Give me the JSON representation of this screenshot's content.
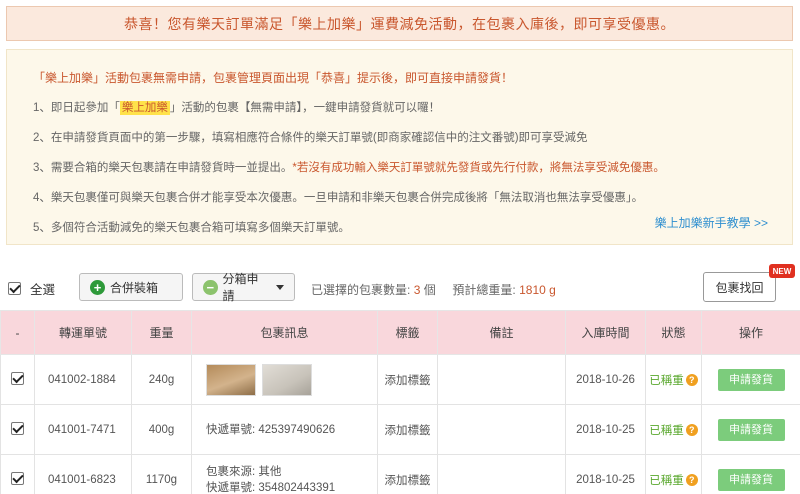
{
  "banner": {
    "text": "恭喜！您有樂天訂單滿足「樂上加樂」運費減免活動，在包裹入庫後，即可享受優惠。"
  },
  "info": {
    "intro": "「樂上加樂」活動包裹無需申請，包裹管理頁面出現「恭喜」提示後，即可直接申請發貨！",
    "item1_a": "1、即日起參加「",
    "item1_hl": "樂上加樂",
    "item1_b": "」活動的包裹【無需申請】，一鍵申請發貨就可以囉！",
    "item2": "2、在申請發貨頁面中的第一步驟，填寫相應符合條件的樂天訂單號(即商家確認信中的注文番號)即可享受減免",
    "item3_a": "3、需要合箱的樂天包裹請在申請發貨時一並提出。",
    "item3_b": "*若沒有成功輸入樂天訂單號就先發貨或先行付款，將無法享受減免優惠。",
    "item4": "4、樂天包裹僅可與樂天包裹合併才能享受本次優惠。一旦申請和非樂天包裹合併完成後將「無法取消也無法享受優惠」。",
    "item5": "5、多個符合活動減免的樂天包裹合箱可填寫多個樂天訂單號。",
    "tutorial_link": "樂上加樂新手教學 >>"
  },
  "toolbar": {
    "select_all": "全選",
    "merge": "合併裝箱",
    "split": "分箱申請",
    "selected_label": "已選擇的包裹數量:",
    "selected_count": "3",
    "selected_unit": "個",
    "weight_label": "預計總重量:",
    "weight_value": "1810 g",
    "find": "包裹找回",
    "new_badge": "NEW"
  },
  "table": {
    "headers": [
      "-",
      "轉運單號",
      "重量",
      "包裹訊息",
      "標籤",
      "備註",
      "入庫時間",
      "狀態",
      "操作"
    ],
    "rows": [
      {
        "id": "041002-1884",
        "weight": "240g",
        "info_line1": "",
        "info_line2": "",
        "tag": "添加標籤",
        "note": "",
        "date": "2018-10-26",
        "status": "已稱重",
        "action": "申請發貨"
      },
      {
        "id": "041001-7471",
        "weight": "400g",
        "info_line1": "快遞單號: 425397490626",
        "info_line2": "",
        "tag": "添加標籤",
        "note": "",
        "date": "2018-10-25",
        "status": "已稱重",
        "action": "申請發貨"
      },
      {
        "id": "041001-6823",
        "weight": "1170g",
        "info_line1": "包裹來源: 其他",
        "info_line2": "快遞單號: 354802443391",
        "tag": "添加標籤",
        "note": "",
        "date": "2018-10-25",
        "status": "已稱重",
        "action": "申請發貨"
      }
    ]
  },
  "colors": {
    "accent": "#c9572e",
    "header_bg": "#f9d7dc",
    "apply_btn": "#7ccc7c",
    "status": "#5aa82e"
  }
}
